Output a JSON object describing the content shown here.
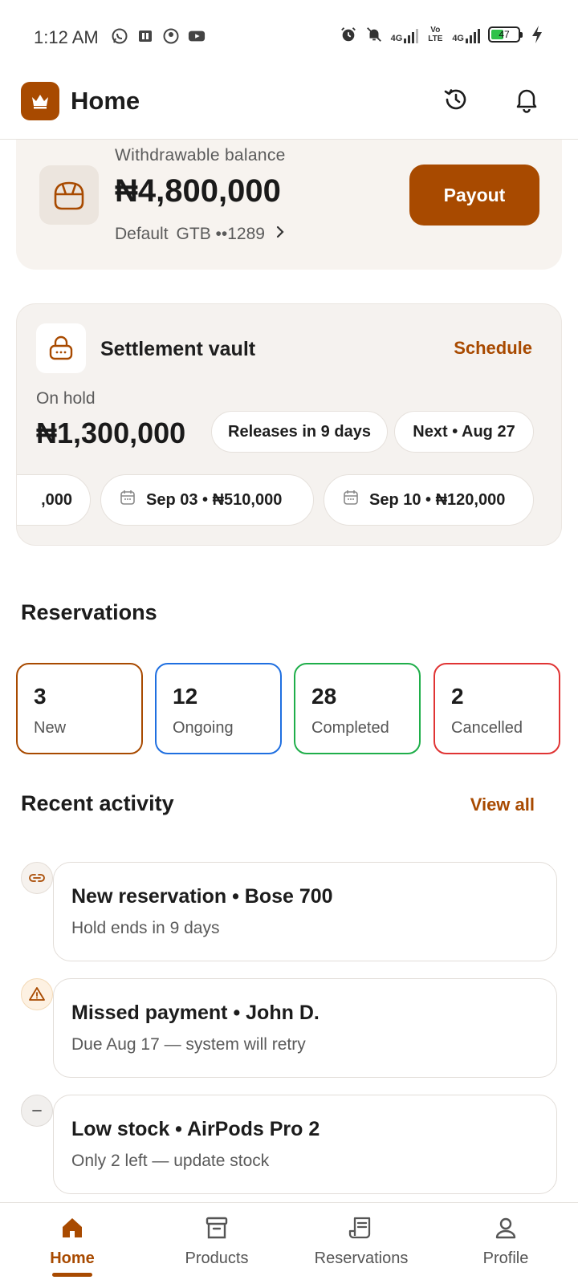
{
  "status_bar": {
    "time": "1:12 AM",
    "left_icons": [
      "whatsapp-icon",
      "wallet-app-icon",
      "messenger-icon",
      "youtube-icon"
    ],
    "right_icons": [
      "alarm-icon",
      "notifications-muted-icon",
      "signal-icon",
      "volte-icon",
      "signal-icon"
    ],
    "net1": "4G",
    "volte": "Vo LTE",
    "net2": "4G",
    "battery": "47",
    "battery_level": 0.47,
    "charging": true
  },
  "header": {
    "title": "Home",
    "logo_icon": "crown-icon",
    "history_icon": "history-icon",
    "notifications_icon": "bell-icon"
  },
  "balance": {
    "label": "Withdrawable balance",
    "amount": "₦4,800,000",
    "account_default": "Default",
    "account_bank": "GTB ••1289",
    "payout_label": "Payout"
  },
  "vault": {
    "title": "Settlement vault",
    "schedule_label": "Schedule",
    "onhold_label": "On hold",
    "onhold_amount": "₦1,300,000",
    "releases_pill": "Releases in 9 days",
    "next_pill": "Next • Aug 27",
    "chips": [
      {
        "label": ",000"
      },
      {
        "label": "Sep 03 • ₦510,000"
      },
      {
        "label": "Sep 10 • ₦120,000"
      }
    ]
  },
  "reservations": {
    "title": "Reservations",
    "cards": [
      {
        "count": "3",
        "label": "New",
        "color": "#a84a00"
      },
      {
        "count": "12",
        "label": "Ongoing",
        "color": "#1f6fe0"
      },
      {
        "count": "28",
        "label": "Completed",
        "color": "#1fae4a"
      },
      {
        "count": "2",
        "label": "Cancelled",
        "color": "#e03434"
      }
    ]
  },
  "activity": {
    "title": "Recent activity",
    "view_all": "View all",
    "items": [
      {
        "icon": "link-icon",
        "title": "New reservation • Bose 700",
        "subtitle": "Hold ends in 9 days"
      },
      {
        "icon": "warning-icon",
        "title": "Missed payment • John D.",
        "subtitle": "Due Aug 17 — system will retry"
      },
      {
        "icon": "minus-icon",
        "title": "Low stock • AirPods Pro 2",
        "subtitle": "Only 2 left — update stock"
      }
    ]
  },
  "bottom_nav": {
    "items": [
      {
        "label": "Home",
        "icon": "home-icon",
        "active": true
      },
      {
        "label": "Products",
        "icon": "archive-box-icon",
        "active": false
      },
      {
        "label": "Reservations",
        "icon": "receipt-icon",
        "active": false
      },
      {
        "label": "Profile",
        "icon": "user-icon",
        "active": false
      }
    ]
  },
  "colors": {
    "accent": "#a84a00",
    "ongoing": "#1f6fe0",
    "completed": "#1fae4a",
    "cancelled": "#e03434"
  }
}
